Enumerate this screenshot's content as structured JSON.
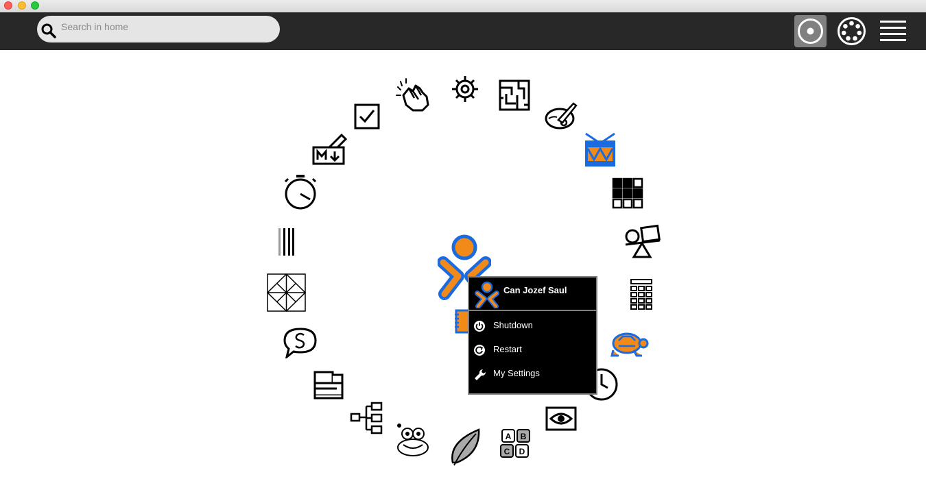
{
  "search": {
    "placeholder": "Search in home"
  },
  "toolbar": {
    "views": [
      {
        "name": "home-view",
        "active": true
      },
      {
        "name": "neighborhood-view",
        "active": false
      },
      {
        "name": "list-view",
        "active": false
      }
    ]
  },
  "user": {
    "name": "Can Jozef Saul",
    "stroke_color": "#1a6ae0",
    "fill_color": "#f28a1a"
  },
  "palette": {
    "items": [
      {
        "label": "Shutdown",
        "icon": "power-icon"
      },
      {
        "label": "Restart",
        "icon": "restart-icon"
      },
      {
        "label": "My Settings",
        "icon": "wrench-icon"
      }
    ]
  },
  "activities": [
    "clapping-hands-icon",
    "gear-icon",
    "maze-icon",
    "paint-palette-icon",
    "drum-icon",
    "grid-blocks-icon",
    "physics-icon",
    "calculator-icon",
    "turtle-icon",
    "clock-icon",
    "eye-icon",
    "abcd-blocks-icon",
    "leaf-icon",
    "frog-icon",
    "tree-diagram-icon",
    "printer-icon",
    "speech-bubble-s-icon",
    "diamond-grid-icon",
    "tally-bars-icon",
    "stopwatch-icon",
    "markdown-icon",
    "checkbox-icon",
    "journal-icon"
  ]
}
